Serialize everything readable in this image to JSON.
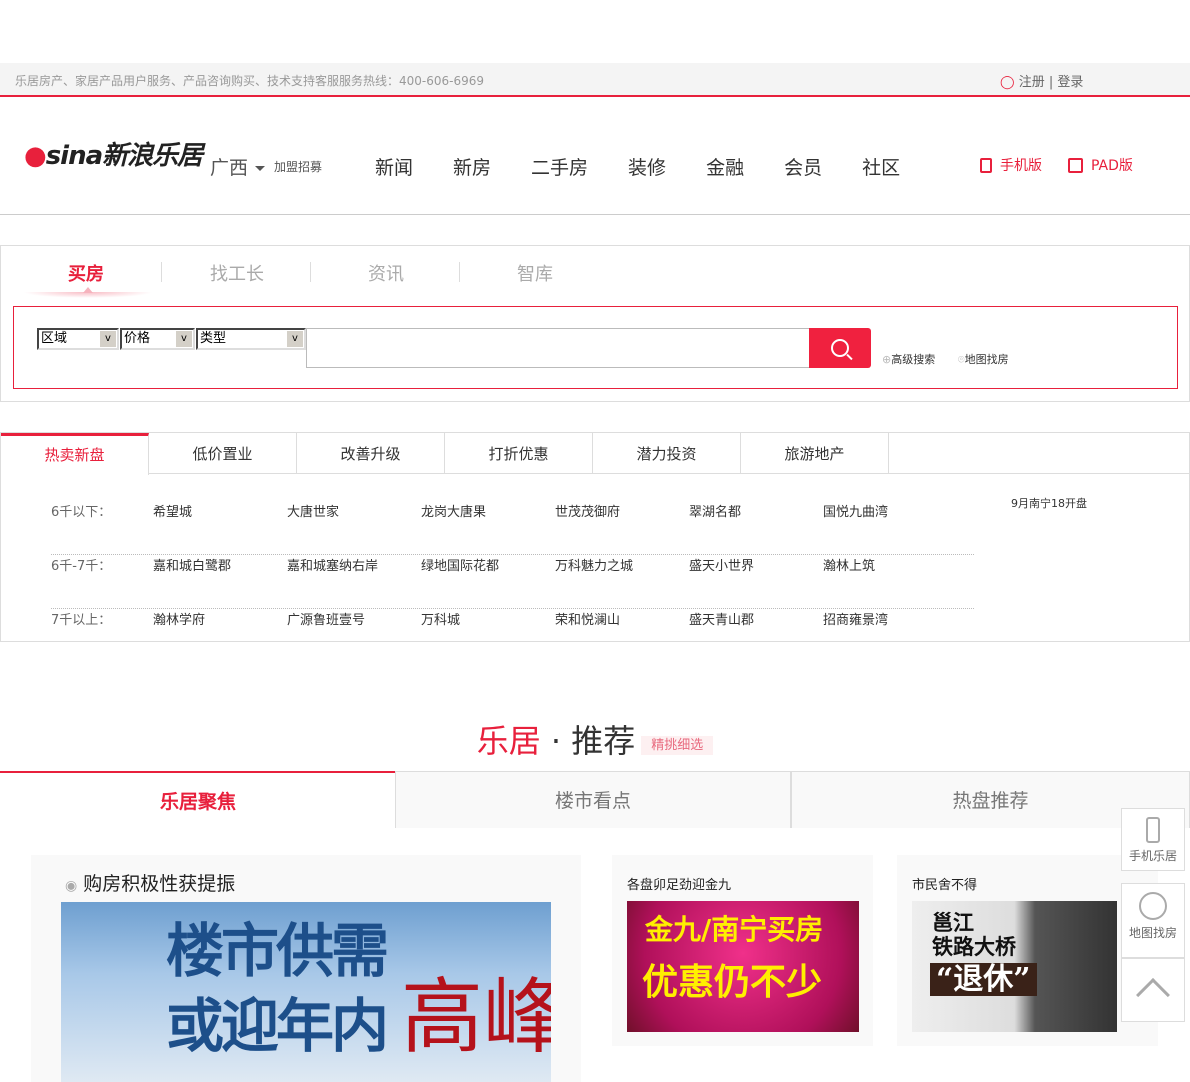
{
  "topbar": {
    "hotline": "乐居房产、家居产品用户服务、产品咨询购买、技术支持客服服务热线：400-606-6969",
    "register": "注册",
    "divider": "|",
    "login": "登录"
  },
  "header": {
    "logo_text": "新浪乐居",
    "logo_brand": "sina",
    "city": "广西",
    "join": "加盟招募",
    "nav": [
      "新闻",
      "新房",
      "二手房",
      "装修",
      "金融",
      "会员",
      "社区"
    ],
    "mobile": "手机版",
    "pad": "PAD版"
  },
  "search": {
    "tabs": [
      "买房",
      "找工长",
      "资讯",
      "智库"
    ],
    "selects": [
      "区域",
      "价格",
      "类型"
    ],
    "input_value": "",
    "advanced": "高级搜索",
    "map": "地图找房"
  },
  "hot": {
    "tabs": [
      "热卖新盘",
      "低价置业",
      "改善升级",
      "打折优惠",
      "潜力投资",
      "旅游地产"
    ],
    "rows": [
      {
        "label": "6千以下：",
        "items": [
          "希望城",
          "大唐世家",
          "龙岗大唐果",
          "世茂茂御府",
          "翠湖名都",
          "国悦九曲湾"
        ]
      },
      {
        "label": "6千-7千：",
        "items": [
          "嘉和城白鹭郡",
          "嘉和城塞纳右岸",
          "绿地国际花都",
          "万科魅力之城",
          "盛天小世界",
          "瀚林上筑"
        ]
      },
      {
        "label": "7千以上：",
        "items": [
          "瀚林学府",
          "广源鲁班壹号",
          "万科城",
          "荣和悦澜山",
          "盛天青山郡",
          "招商雍景湾"
        ]
      }
    ],
    "side_note": "9月南宁18开盘"
  },
  "recommend": {
    "title_red": "乐居",
    "title_dot": "·",
    "title_black": "推荐",
    "tag": "精挑细选",
    "tabs": [
      "乐居聚焦",
      "楼市看点",
      "热盘推荐"
    ],
    "main_card": {
      "title": "购房积极性获提振",
      "img_lines": [
        "楼市供需",
        "或迎年内"
      ],
      "img_accent": "高峰"
    },
    "cards": [
      {
        "title": "各盘卯足劲迎金九",
        "img_lines": [
          "金九/南宁买房",
          "优惠仍不少"
        ]
      },
      {
        "title": "市民舍不得",
        "img_lines": [
          "邕江",
          "铁路大桥",
          "“退休”"
        ]
      }
    ]
  },
  "float": {
    "mobile": "手机乐居",
    "map": "地图找房"
  },
  "colors": {
    "accent": "#e8203c"
  }
}
